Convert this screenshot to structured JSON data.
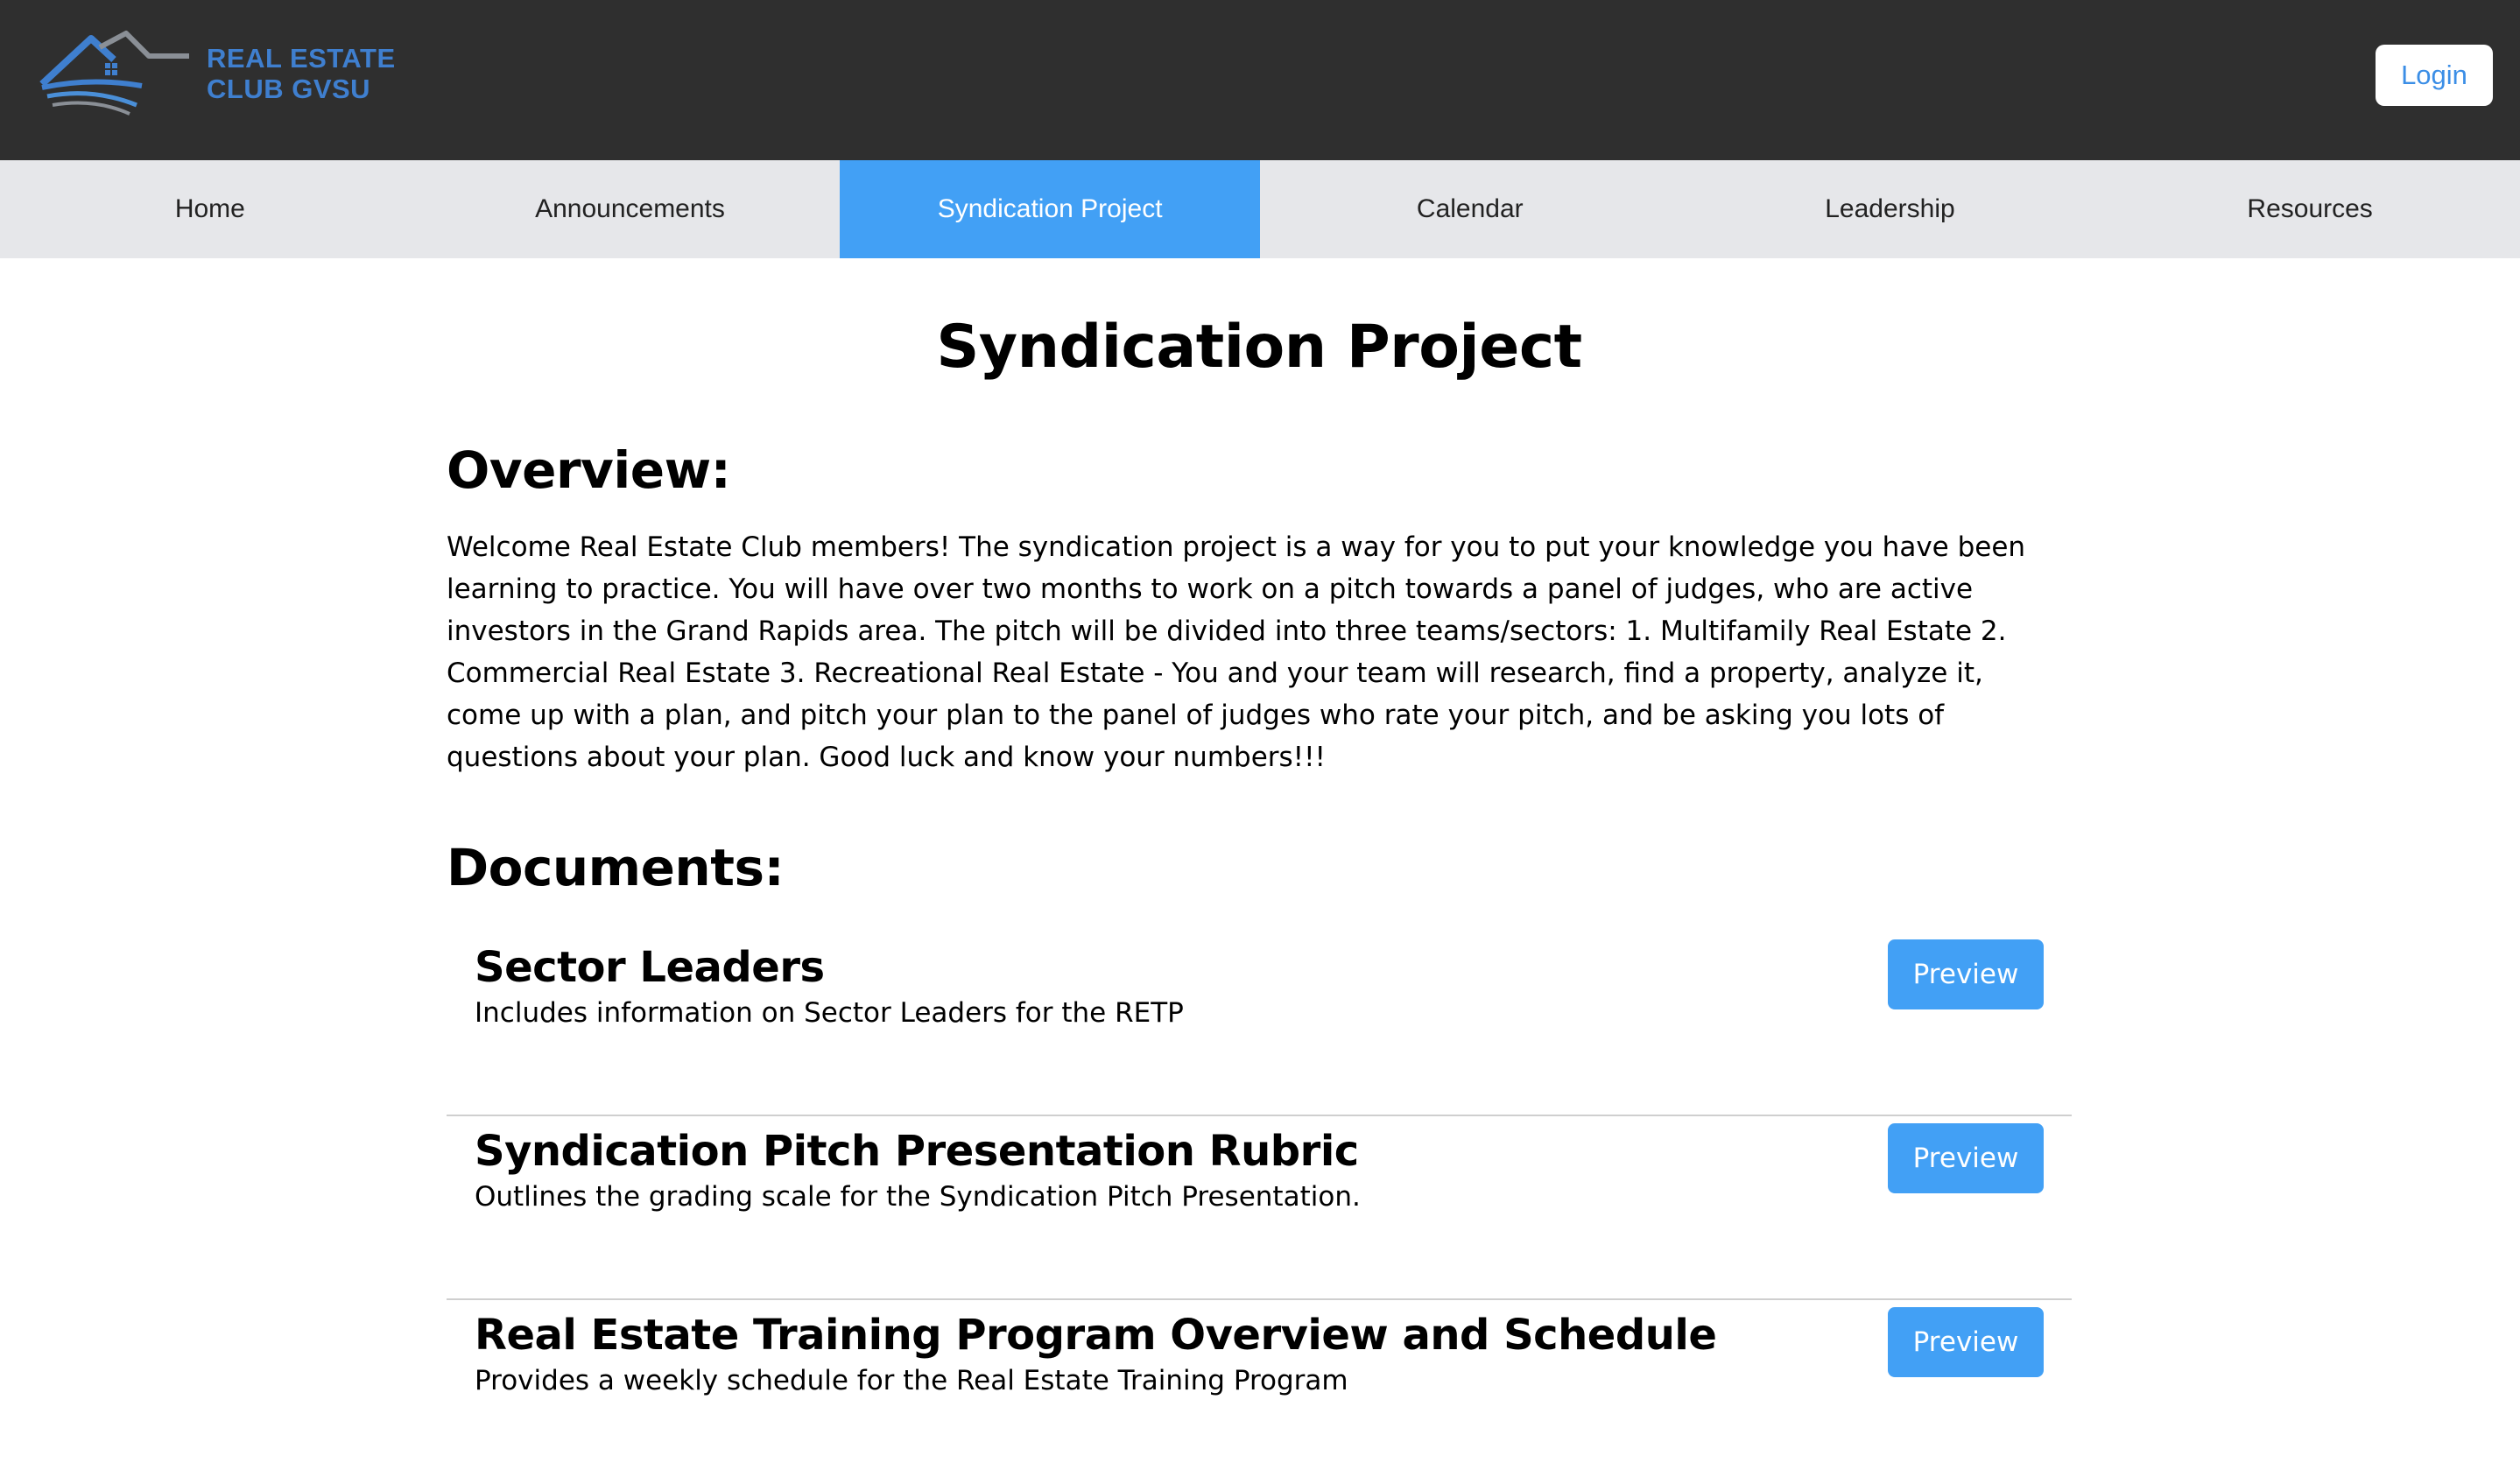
{
  "header": {
    "logo_line1": "REAL ESTATE",
    "logo_line2": "CLUB GVSU",
    "login_label": "Login"
  },
  "nav": {
    "items": [
      {
        "label": "Home"
      },
      {
        "label": "Announcements"
      },
      {
        "label": "Syndication Project",
        "active": true
      },
      {
        "label": "Calendar"
      },
      {
        "label": "Leadership"
      },
      {
        "label": "Resources"
      }
    ]
  },
  "main": {
    "title": "Syndication Project",
    "overview_heading": "Overview:",
    "overview_text": "Welcome Real Estate Club members! The syndication project is a way for you to put your knowledge you have been learning to practice. You will have over two months to work on a pitch towards a panel of judges, who are active investors in the Grand Rapids area. The pitch will be divided into three teams/sectors: 1. Multifamily Real Estate 2. Commercial Real Estate 3. Recreational Real Estate - You and your team will research, find a property, analyze it, come up with a plan, and pitch your plan to the panel of judges who rate your pitch, and be asking you lots of questions about your plan. Good luck and know your numbers!!!",
    "documents_heading": "Documents:",
    "documents": [
      {
        "title": "Sector Leaders",
        "description": "Includes information on Sector Leaders for the RETP",
        "button": "Preview"
      },
      {
        "title": "Syndication Pitch Presentation Rubric",
        "description": "Outlines the grading scale for the Syndication Pitch Presentation.",
        "button": "Preview"
      },
      {
        "title": "Real Estate Training Program Overview and Schedule",
        "description": "Provides a weekly schedule for the Real Estate Training Program",
        "button": "Preview"
      }
    ]
  },
  "colors": {
    "header_bg": "#2f2f2f",
    "nav_bg": "#e6e7ea",
    "accent": "#42a0f5",
    "logo_blue": "#3f7fcf"
  }
}
